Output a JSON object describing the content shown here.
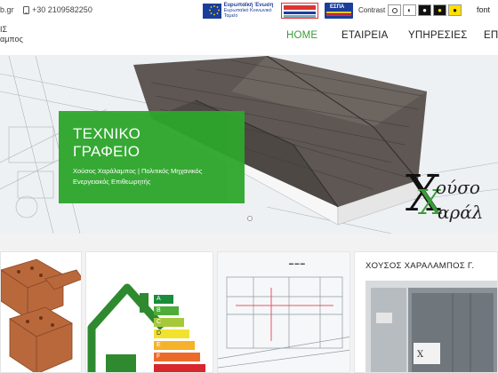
{
  "topbar": {
    "email_fragment": "b.gr",
    "phone": "+30 2109582250",
    "eu_title": "Ευρωπαϊκή Ένωση",
    "eu_fund": "Ευρωπαϊκό Κοινωνικό Ταμείο",
    "ellada_label": "ΕΛΛΑΔΑ 2014-2020",
    "espa_label": "ΕΣΠΑ",
    "contrast_label": "Contrast",
    "lang": "font"
  },
  "header": {
    "logo_line1": "ΙΣ",
    "logo_line2": "αμπος",
    "nav": [
      "HOME",
      "ΕΤΑΙΡΕΙΑ",
      "ΥΠΗΡΕΣΙΕΣ",
      "ΕΠ"
    ]
  },
  "hero": {
    "title_line1": "ΤΕΧΝΙΚΟ",
    "title_line2": "ΓΡΑΦΕΙΟ",
    "subtitle_line1": "Χούσος Χαράλαμπος | Πολιτικός Μηχανικός",
    "subtitle_line2": "Ενεργειακός Επιθεωρητής",
    "brand_word1": "ούσο",
    "brand_word2": "αράλ"
  },
  "energy_classes": [
    "A",
    "B",
    "C",
    "D",
    "E",
    "F"
  ],
  "side_card": {
    "title": "ΧΟΥΣΟΣ ΧΑΡΑΛΑΜΠΟΣ Γ."
  },
  "colors": {
    "accent_green": "#3b9b3a",
    "hero_box": "#2da62b"
  }
}
